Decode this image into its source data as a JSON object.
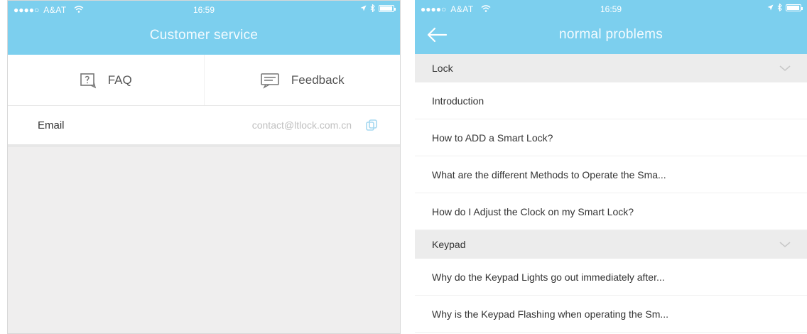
{
  "left": {
    "status": {
      "carrier": "A&AT",
      "time": "16:59"
    },
    "title": "Customer service",
    "tabs": [
      {
        "label": "FAQ",
        "icon": "faq-icon"
      },
      {
        "label": "Feedback",
        "icon": "feedback-icon"
      }
    ],
    "email": {
      "label": "Email",
      "value": "contact@ltlock.com.cn",
      "icon": "copy-icon"
    }
  },
  "right": {
    "status": {
      "carrier": "A&AT",
      "time": "16:59"
    },
    "title": "normal problems",
    "sections": [
      {
        "title": "Lock",
        "items": [
          "Introduction",
          "How to ADD a Smart Lock?",
          "What are the different Methods to Operate the Sma...",
          "How do I Adjust the Clock on my Smart Lock?"
        ]
      },
      {
        "title": "Keypad",
        "items": [
          "Why do the Keypad Lights go out immediately after...",
          "Why is the Keypad Flashing when operating the Sm..."
        ]
      }
    ]
  },
  "colors": {
    "header": "#7ccfee",
    "background": "#efeeee",
    "section": "#ececec"
  }
}
